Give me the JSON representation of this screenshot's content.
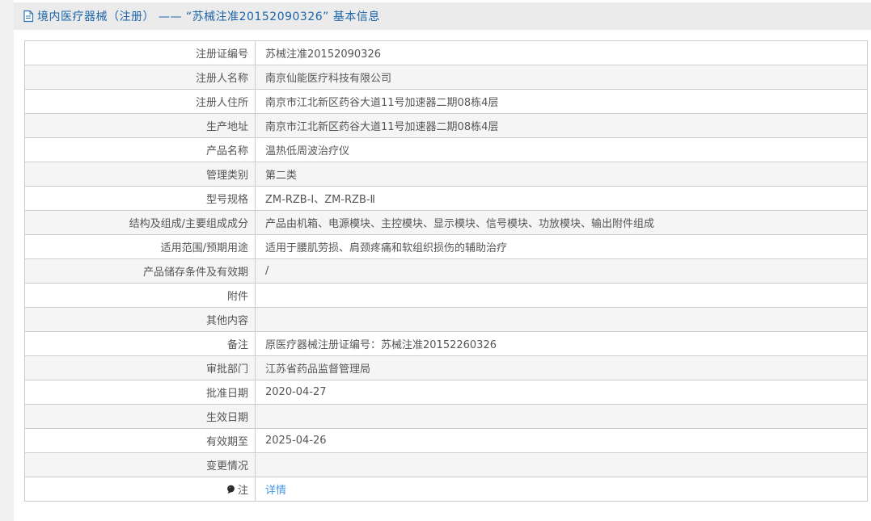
{
  "header": {
    "title": "境内医疗器械（注册） —— “苏械注准20152090326” 基本信息"
  },
  "colors": {
    "title_blue": "#1e64a8",
    "link_blue": "#4596e0",
    "header_bar_bg": "#ebebeb",
    "row_alt_bg": "#f5f5f5",
    "border": "#cccccc",
    "text": "#555555"
  },
  "table": {
    "rows": [
      {
        "label": "注册证编号",
        "value": "苏械注准20152090326"
      },
      {
        "label": "注册人名称",
        "value": "南京仙能医疗科技有限公司"
      },
      {
        "label": "注册人住所",
        "value": "南京市江北新区药谷大道11号加速器二期08栋4层"
      },
      {
        "label": "生产地址",
        "value": "南京市江北新区药谷大道11号加速器二期08栋4层"
      },
      {
        "label": "产品名称",
        "value": "温热低周波治疗仪"
      },
      {
        "label": "管理类别",
        "value": "第二类"
      },
      {
        "label": "型号规格",
        "value": "ZM-RZB-Ⅰ、ZM-RZB-Ⅱ"
      },
      {
        "label": "结构及组成/主要组成成分",
        "value": "产品由机箱、电源模块、主控模块、显示模块、信号模块、功放模块、输出附件组成"
      },
      {
        "label": "适用范围/预期用途",
        "value": "适用于腰肌劳损、肩颈疼痛和软组织损伤的辅助治疗"
      },
      {
        "label": "产品储存条件及有效期",
        "value": "/"
      },
      {
        "label": "附件",
        "value": ""
      },
      {
        "label": "其他内容",
        "value": ""
      },
      {
        "label": "备注",
        "value": "原医疗器械注册证编号：苏械注准20152260326"
      },
      {
        "label": "审批部门",
        "value": "江苏省药品监督管理局"
      },
      {
        "label": "批准日期",
        "value": "2020-04-27"
      },
      {
        "label": "生效日期",
        "value": ""
      },
      {
        "label": "有效期至",
        "value": "2025-04-26"
      },
      {
        "label": "变更情况",
        "value": ""
      },
      {
        "label": "注",
        "value": "详情",
        "value_is_link": true,
        "label_icon": "note-balloon-icon"
      }
    ]
  }
}
